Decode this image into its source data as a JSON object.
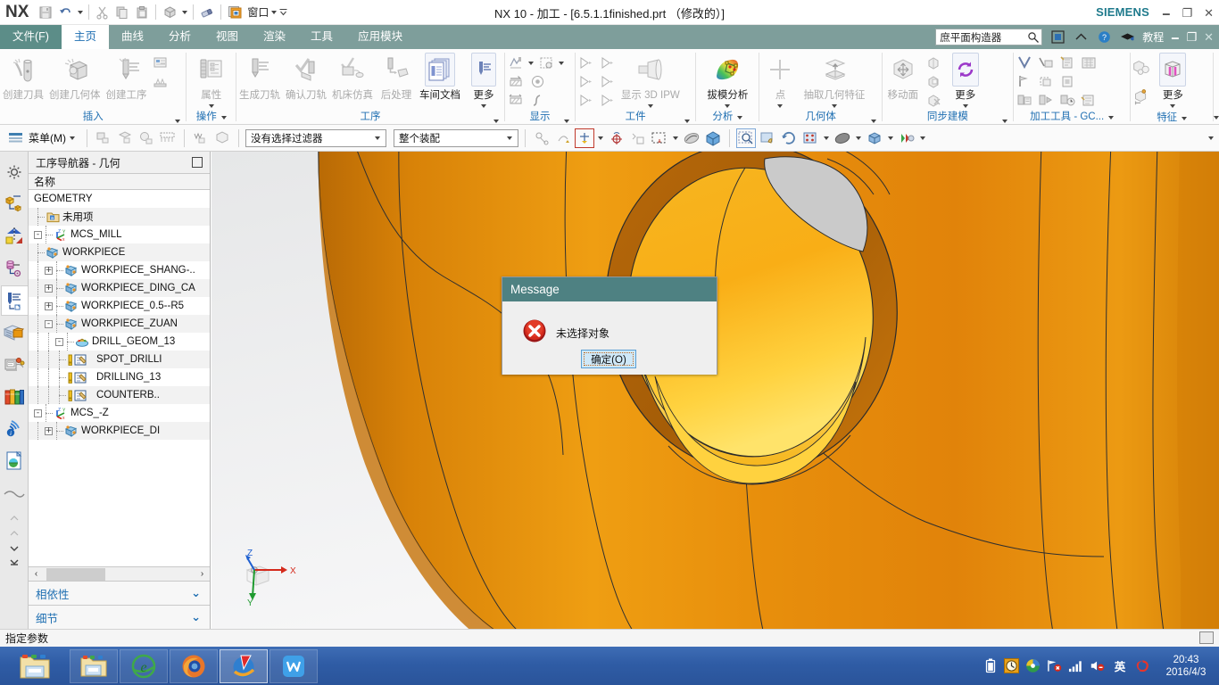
{
  "titlebar": {
    "logo": "NX",
    "window_menu_label": "窗口",
    "title": "NX 10 - 加工 - [6.5.1.1finished.prt （修改的）]",
    "brand": "SIEMENS",
    "quick_access": [
      {
        "name": "save-icon",
        "label": "保存"
      },
      {
        "name": "undo-icon",
        "label": "撤销"
      },
      {
        "name": "cut-icon",
        "label": "剪切"
      },
      {
        "name": "copy-icon",
        "label": "复制"
      },
      {
        "name": "paste-icon",
        "label": "粘贴"
      },
      {
        "name": "display-mode-icon",
        "label": "显示"
      },
      {
        "name": "eraser-icon",
        "label": "擦除"
      }
    ],
    "window_buttons": [
      "_",
      "❐",
      "✕"
    ]
  },
  "tabs": [
    {
      "label": "文件(F)",
      "state": "file"
    },
    {
      "label": "主页",
      "state": "active"
    },
    {
      "label": "曲线",
      "state": "normal"
    },
    {
      "label": "分析",
      "state": "normal"
    },
    {
      "label": "视图",
      "state": "normal"
    },
    {
      "label": "渲染",
      "state": "normal"
    },
    {
      "label": "工具",
      "state": "normal"
    },
    {
      "label": "应用模块",
      "state": "normal"
    }
  ],
  "tabbar_right": {
    "search_value": "庶平面构造器",
    "tutorial_label": "教程",
    "icons": [
      "full-screen-icon",
      "collapse-ribbon-icon",
      "help-icon",
      "graduation-cap-icon"
    ],
    "window_buttons": [
      "_",
      "❐",
      "✕"
    ]
  },
  "ribbon": {
    "groups": [
      {
        "title": "插入",
        "buttons": [
          {
            "label": "创建刀具",
            "icon": "create-tool-icon",
            "enabled": false
          },
          {
            "label": "创建几何体",
            "icon": "create-geometry-icon",
            "enabled": false
          },
          {
            "label": "创建工序",
            "icon": "create-operation-icon",
            "enabled": false
          }
        ],
        "small": [
          "create-program-icon",
          "create-method-icon"
        ]
      },
      {
        "title": "操作",
        "buttons": [
          {
            "label": "属性",
            "icon": "properties-icon",
            "enabled": false,
            "has_menu": true
          }
        ]
      },
      {
        "title": "工序",
        "buttons": [
          {
            "label": "生成刀轨",
            "icon": "generate-toolpath-icon",
            "enabled": false
          },
          {
            "label": "确认刀轨",
            "icon": "verify-toolpath-icon",
            "enabled": false
          },
          {
            "label": "机床仿真",
            "icon": "machine-sim-icon",
            "enabled": false
          },
          {
            "label": "后处理",
            "icon": "postprocess-icon",
            "enabled": false
          },
          {
            "label": "车间文档",
            "icon": "shop-doc-icon",
            "enabled": true,
            "boxed": true
          },
          {
            "label": "更多",
            "icon": "more-toolpath-icon",
            "enabled": true,
            "boxed": true,
            "has_menu": true
          }
        ]
      },
      {
        "title": "显示",
        "small": [
          "display-toolpath-icon",
          "display-dropdown-icon",
          "reverse-path-icon",
          "play-path-icon",
          "toolpath-length-icon",
          "curve-icon"
        ]
      },
      {
        "title": "工件",
        "buttons": [
          {
            "label": "显示 3D IPW",
            "icon": "show-3d-ipw-icon",
            "enabled": false,
            "has_menu": true
          }
        ],
        "small": [
          "ipw-1-icon",
          "ipw-2-icon",
          "ipw-3-icon",
          "ipw-4-icon",
          "ipw-5-icon",
          "ipw-6-icon"
        ]
      },
      {
        "title": "分析",
        "buttons": [
          {
            "label": "拔模分析",
            "icon": "draft-analysis-icon",
            "enabled": true,
            "has_menu": true
          }
        ]
      },
      {
        "title": "几何体",
        "buttons": [
          {
            "label": "点",
            "icon": "point-icon",
            "enabled": false,
            "has_menu": true
          },
          {
            "label": "抽取几何特征",
            "icon": "extract-geometry-icon",
            "enabled": false,
            "has_menu": true
          }
        ]
      },
      {
        "title": "同步建模",
        "buttons": [
          {
            "label": "移动面",
            "icon": "move-face-icon",
            "enabled": false
          },
          {
            "label": "更多",
            "icon": "sync-more-icon",
            "enabled": true,
            "boxed": true,
            "has_menu": true
          }
        ],
        "small": [
          "offset-region-icon",
          "replace-face-icon",
          "delete-face-icon"
        ]
      },
      {
        "title": "加工工具 - GC...",
        "small": [
          "gc-1-icon",
          "gc-2-icon",
          "gc-3-icon",
          "gc-4-icon",
          "gc-5-icon",
          "gc-6-icon",
          "gc-7-icon",
          "gc-8-icon",
          "gc-9-icon",
          "gc-10-icon",
          "gc-11-icon",
          "gc-12-icon"
        ]
      },
      {
        "title": "特征",
        "buttons": [
          {
            "label": "更多",
            "icon": "feature-more-icon",
            "enabled": true,
            "boxed": true,
            "has_menu": true
          }
        ],
        "small": [
          "feature-1-icon",
          "feature-2-icon"
        ]
      }
    ]
  },
  "selection_bar": {
    "menu_label": "菜单(M)",
    "filter_value": "没有选择过滤器",
    "scope_value": "整个装配",
    "icons_left": [
      "sel-obj-icon",
      "sel-face-icon",
      "sel-edge-icon",
      "sel-body-icon",
      "sel-feat-icon",
      "sel-comp-icon"
    ],
    "icons_right": [
      "snap-point-icon",
      "point-dialog-icon",
      "curve-rule-icon",
      "rect-select-icon",
      "shaded-icon",
      "solid-icon",
      "zoom-icon",
      "pan-icon",
      "rotate-icon",
      "fit-icon",
      "shade-mode-icon",
      "render-style-icon",
      "layer-icon"
    ]
  },
  "resource_bar": {
    "items": [
      {
        "name": "resource-gear-icon",
        "selected": false
      },
      {
        "name": "assembly-navigator-icon",
        "selected": false
      },
      {
        "name": "constraint-navigator-icon",
        "selected": false
      },
      {
        "name": "part-navigator-icon",
        "selected": false
      },
      {
        "name": "operation-navigator-icon",
        "selected": true
      },
      {
        "name": "reuse-library-icon",
        "selected": false
      },
      {
        "name": "machining-wizard-icon",
        "selected": false
      },
      {
        "name": "roles-icon",
        "selected": false
      },
      {
        "name": "internet-explorer-icon",
        "selected": false
      },
      {
        "name": "history-icon",
        "selected": false
      },
      {
        "name": "process-studio-icon",
        "selected": false
      }
    ]
  },
  "navigator": {
    "title": "工序导航器 - 几何",
    "column_header": "名称",
    "tree": [
      {
        "label": "GEOMETRY",
        "indent": 0,
        "icon": "",
        "expander": "",
        "guides": 0
      },
      {
        "label": "未用项",
        "indent": 1,
        "icon": "unused-items-icon",
        "expander": "",
        "guides": 1
      },
      {
        "label": "MCS_MILL",
        "indent": 1,
        "icon": "mcs-icon",
        "expander": "-",
        "guides": 0
      },
      {
        "label": "WORKPIECE",
        "indent": 2,
        "icon": "workpiece-icon",
        "expander": "",
        "guides": 1
      },
      {
        "label": "WORKPIECE_SHANG-..",
        "indent": 2,
        "icon": "workpiece-icon",
        "expander": "+",
        "guides": 1
      },
      {
        "label": "WORKPIECE_DING_CA",
        "indent": 2,
        "icon": "workpiece-icon",
        "expander": "+",
        "guides": 1
      },
      {
        "label": "WORKPIECE_0.5--R5",
        "indent": 2,
        "icon": "workpiece-icon",
        "expander": "+",
        "guides": 1
      },
      {
        "label": "WORKPIECE_ZUAN",
        "indent": 2,
        "icon": "workpiece-icon",
        "expander": "-",
        "guides": 1
      },
      {
        "label": "DRILL_GEOM_13",
        "indent": 3,
        "icon": "drill-geom-icon",
        "expander": "-",
        "guides": 2
      },
      {
        "label": "SPOT_DRILLI",
        "indent": 4,
        "icon": "operation-warn-icon",
        "expander": "",
        "guides": 3
      },
      {
        "label": "DRILLING_13",
        "indent": 4,
        "icon": "operation-warn-icon",
        "expander": "",
        "guides": 3
      },
      {
        "label": "COUNTERB..",
        "indent": 4,
        "icon": "operation-warn-icon",
        "expander": "",
        "guides": 3
      },
      {
        "label": "MCS_-Z",
        "indent": 1,
        "icon": "mcs-icon",
        "expander": "-",
        "guides": 0
      },
      {
        "label": "WORKPIECE_DI",
        "indent": 2,
        "icon": "workpiece-icon",
        "expander": "+",
        "guides": 1
      }
    ],
    "sections": [
      {
        "label": "相依性",
        "chevron": "⌄"
      },
      {
        "label": "细节",
        "chevron": "⌄"
      }
    ],
    "hscroll": {
      "left": "‹",
      "right": "›"
    }
  },
  "viewport": {
    "triad": {
      "x_label": "X",
      "y_label": "Y",
      "z_label": "Z"
    },
    "colors": {
      "model_main": "#e08a10",
      "model_light": "#f0a21c",
      "model_highlight": "#ffd23f",
      "model_shadow": "#b96c07",
      "background_top": "#e8e9ea",
      "background_bottom": "#f7f7f8",
      "edge": "#2a2a2a",
      "hole_gray": "#c9c9c9"
    }
  },
  "dialog": {
    "title": "Message",
    "message": "未选择对象",
    "ok_label": "确定(O)",
    "icon": "error-icon",
    "title_bg": "#4e8182"
  },
  "statusbar": {
    "text": "指定参数"
  },
  "taskbar": {
    "start_icon": "start-folder-icon",
    "items": [
      {
        "name": "file-explorer-icon",
        "active": false
      },
      {
        "name": "internet-explorer-icon",
        "active": false
      },
      {
        "name": "firefox-icon",
        "active": false
      },
      {
        "name": "thunder-download-icon",
        "active": true
      },
      {
        "name": "wps-writer-icon",
        "active": false
      }
    ],
    "tray": [
      "battery-icon",
      "clock-tray-icon",
      "globe-icon",
      "network-error-icon",
      "signal-icon",
      "volume-mute-icon",
      "ime-icon",
      "sogou-icon"
    ],
    "time": "20:43",
    "date": "2016/4/3"
  }
}
